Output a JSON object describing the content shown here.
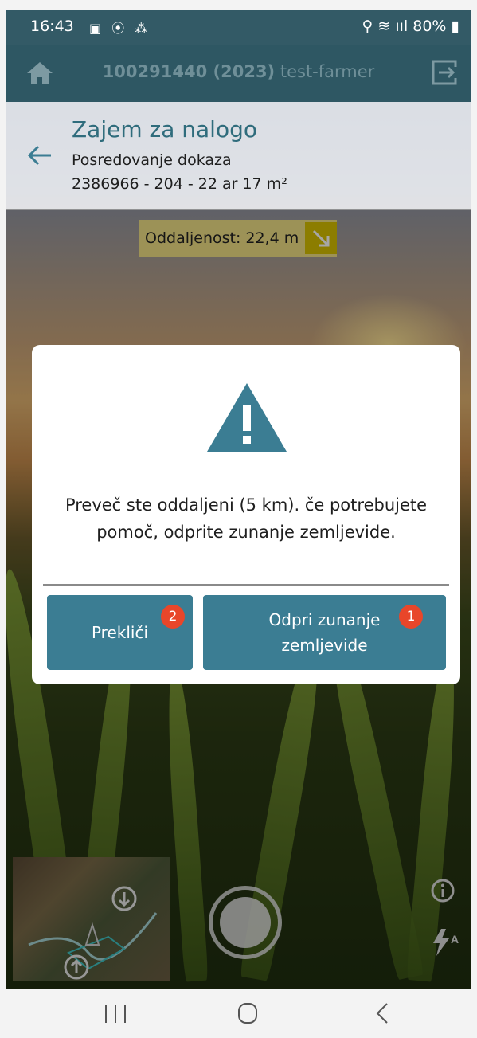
{
  "status_bar": {
    "time": "16:43",
    "notification_icons": "▣ ⦿ ⁂",
    "right": "⚲ ≋ ııl 80% ▮"
  },
  "app_bar": {
    "id_year": "100291440 (2023)",
    "user": "test-farmer",
    "icons": {
      "home": "home-icon",
      "logout": "logout-icon"
    }
  },
  "task": {
    "title": "Zajem za nalogo",
    "subtitle": "Posredovanje dokaza",
    "meta": "2386966 - 204 - 22 ar 17 m²"
  },
  "distance": {
    "label": "Oddaljenost: 22,4 m"
  },
  "dialog": {
    "message": "Preveč ste oddaljeni (5 km). če potrebujete pomoč, odprite zunanje zemljevide.",
    "cancel_label": "Prekliči",
    "open_label": "Odpri zunanje zemljevide",
    "cancel_badge": "2",
    "open_badge": "1",
    "colors": {
      "accent": "#3b7d93",
      "warning": "#3b7d93",
      "badge": "#e8462a"
    }
  },
  "camera": {
    "icons": {
      "info": "info-icon",
      "flash": "flash-auto-icon",
      "shutter": "shutter-button"
    }
  },
  "nav": {
    "icons": [
      "recent-apps-icon",
      "home-circle-icon",
      "back-chevron-icon"
    ]
  }
}
